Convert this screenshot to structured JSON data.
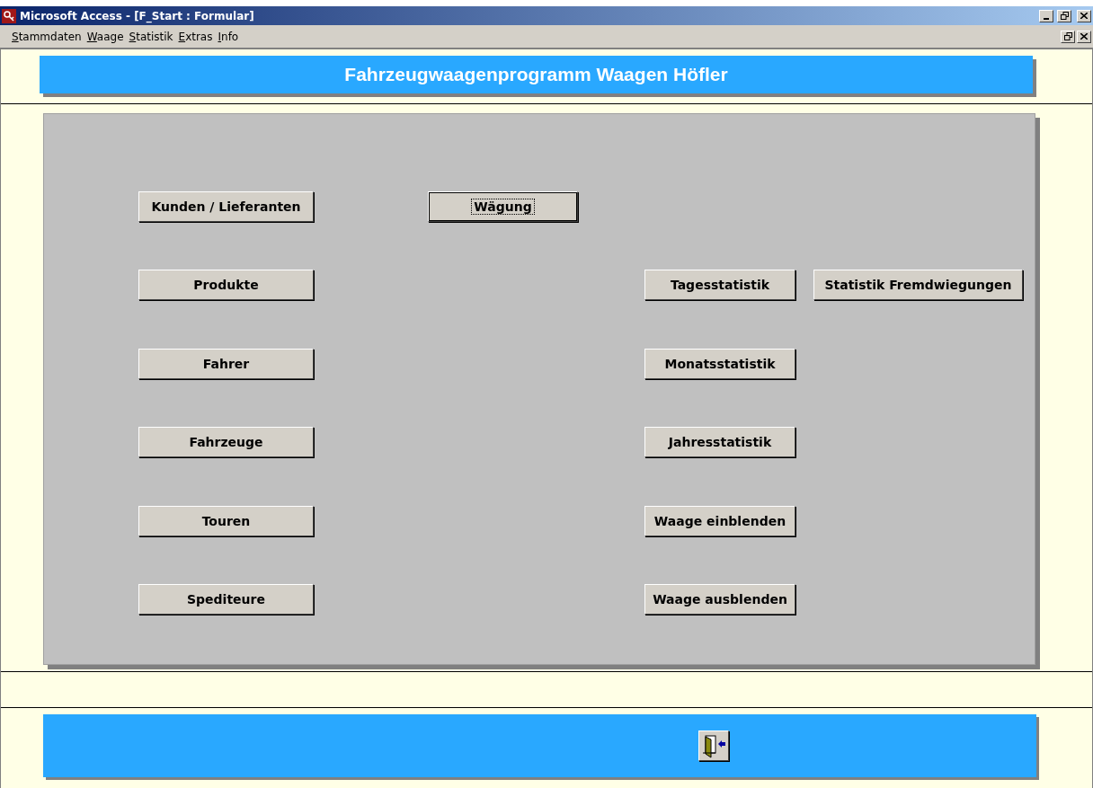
{
  "window": {
    "title": "Microsoft Access - [F_Start : Formular]"
  },
  "menu": [
    "Stammdaten",
    "Waage",
    "Statistik",
    "Extras",
    "Info"
  ],
  "header": {
    "title": "Fahrzeugwaagenprogramm Waagen Höfler"
  },
  "master_data_buttons": [
    "Kunden / Lieferanten",
    "Produkte",
    "Fahrer",
    "Fahrzeuge",
    "Touren",
    "Spediteure"
  ],
  "weighing_button": {
    "label": "Wägung",
    "focused": true
  },
  "statistics_buttons": [
    "Tagesstatistik",
    "Monatsstatistik",
    "Jahresstatistik",
    "Waage einblenden",
    "Waage ausblenden"
  ],
  "extra_button": {
    "label": "Statistik Fremdwiegungen"
  }
}
